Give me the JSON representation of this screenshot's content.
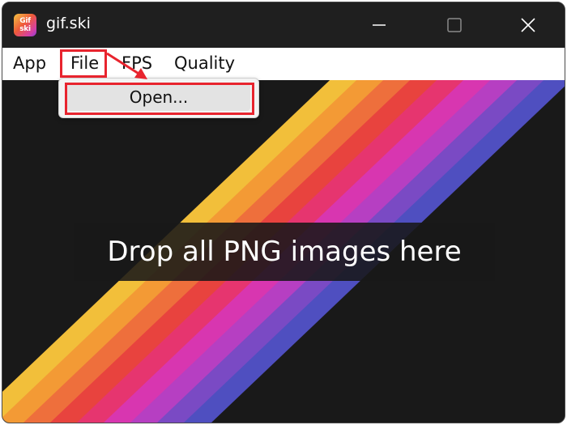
{
  "window": {
    "title": "gif.ski",
    "logo_text_top": "Gif",
    "logo_text_bottom": "ski",
    "controls": {
      "minimize_icon": "minimize-icon",
      "maximize_icon": "maximize-icon",
      "close_icon": "close-icon"
    }
  },
  "menubar": {
    "items": [
      {
        "label": "App"
      },
      {
        "label": "File"
      },
      {
        "label": "FPS"
      },
      {
        "label": "Quality"
      }
    ]
  },
  "file_menu": {
    "items": [
      {
        "label": "Open..."
      }
    ]
  },
  "canvas": {
    "drop_prompt": "Drop all PNG images here",
    "stripe_colors": [
      "#f2bf3a",
      "#f39a35",
      "#ee6f3c",
      "#e8433e",
      "#e6356f",
      "#d836b0",
      "#b63fc2",
      "#7a4ac4",
      "#4f4fc0"
    ],
    "background": "#191919"
  },
  "annotation": {
    "highlight_color": "#e8242e"
  }
}
